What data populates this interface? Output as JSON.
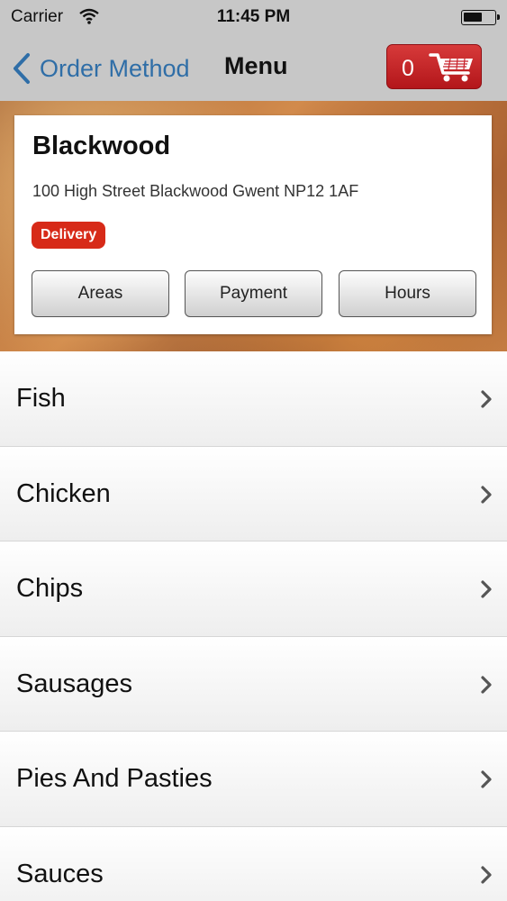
{
  "status": {
    "carrier": "Carrier",
    "time": "11:45 PM"
  },
  "nav": {
    "back_label": "Order Method",
    "title": "Menu",
    "cart_count": "0"
  },
  "shop": {
    "name": "Blackwood",
    "address": "100 High Street Blackwood Gwent NP12 1AF",
    "badge": "Delivery",
    "buttons": [
      "Areas",
      "Payment",
      "Hours"
    ]
  },
  "menu": {
    "items": [
      "Fish",
      "Chicken",
      "Chips",
      "Sausages",
      "Pies And Pasties",
      "Sauces"
    ]
  },
  "colors": {
    "accent_blue": "#2f6ea7",
    "cart_red": "#c8202a",
    "badge_red": "#d72a18"
  }
}
